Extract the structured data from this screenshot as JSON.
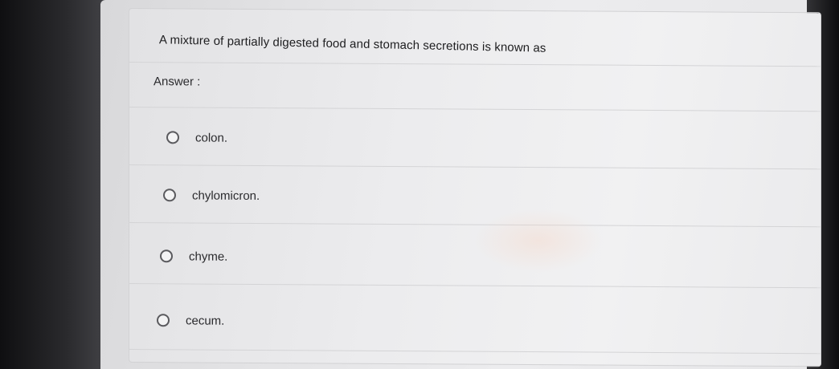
{
  "question": {
    "text": "A mixture of partially digested food and stomach secretions is known as"
  },
  "answer_label": "Answer :",
  "options": [
    {
      "label": "colon.",
      "selected": false
    },
    {
      "label": "chylomicron.",
      "selected": false
    },
    {
      "label": "chyme.",
      "selected": false
    },
    {
      "label": "cecum.",
      "selected": false
    }
  ],
  "colors": {
    "card_background": "#ececee",
    "radio_border": "#5a5a5e",
    "text": "#1e1e20"
  }
}
